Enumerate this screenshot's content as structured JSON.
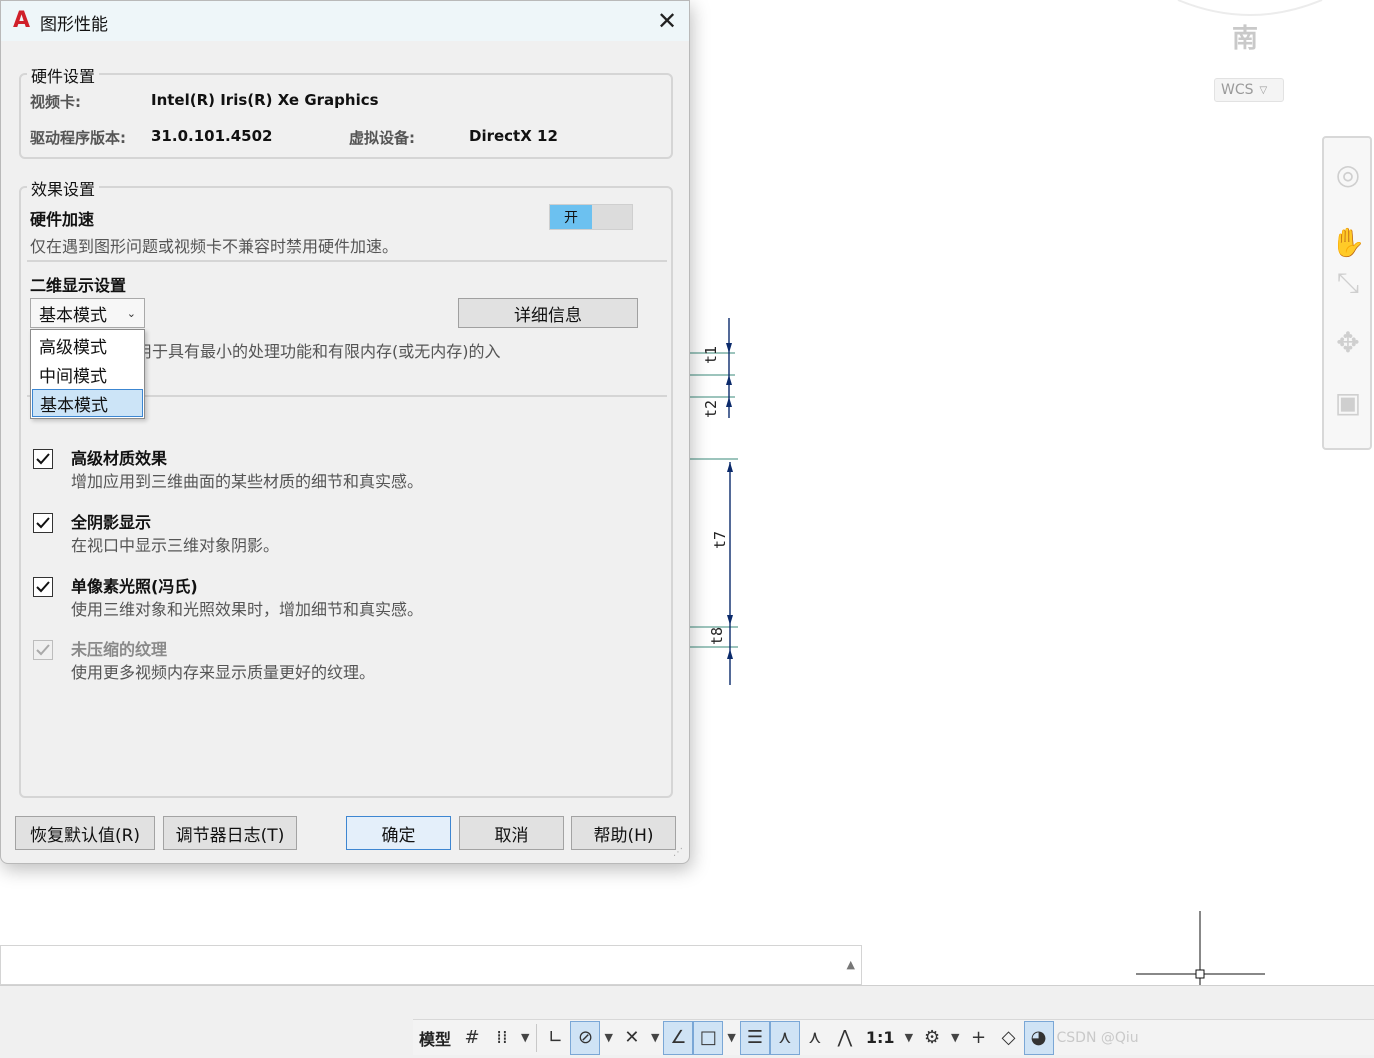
{
  "background": {
    "compass_label": "南",
    "wcs_label": "WCS",
    "dimension_labels": [
      "t1",
      "t2",
      "t7",
      "t8"
    ],
    "line_color": "#0b2a6b"
  },
  "status_bar": {
    "model_label": "模型",
    "scale_label": "1:1",
    "watermark": "CSDN @Qiu"
  },
  "dialog": {
    "title": "图形性能",
    "hardware_group": {
      "legend": "硬件设置",
      "video_card_label": "视频卡:",
      "video_card_value": "Intel(R) Iris(R) Xe Graphics",
      "driver_label": "驱动程序版本:",
      "driver_value": "31.0.101.4502",
      "virtual_device_label": "虚拟设备:",
      "virtual_device_value": "DirectX 12"
    },
    "effects_group": {
      "legend": "效果设置",
      "hw_accel_title": "硬件加速",
      "hw_accel_desc": "仅在遇到图形问题或视频卡不兼容时禁用硬件加速。",
      "hw_accel_toggle": "开",
      "display2d_title": "二维显示设置",
      "display2d_selected": "基本模式",
      "display2d_options": [
        "高级模式",
        "中间模式",
        "基本模式"
      ],
      "display2d_desc_partial": "用于具有最小的处理功能和有限内存(或无内存)的入",
      "details_button": "详细信息",
      "options": [
        {
          "title": "高级材质效果",
          "desc": "增加应用到三维曲面的某些材质的细节和真实感。",
          "checked": true,
          "enabled": true
        },
        {
          "title": "全阴影显示",
          "desc": "在视口中显示三维对象阴影。",
          "checked": true,
          "enabled": true
        },
        {
          "title": "单像素光照(冯氏)",
          "desc": "使用三维对象和光照效果时，增加细节和真实感。",
          "checked": true,
          "enabled": true
        },
        {
          "title": "未压缩的纹理",
          "desc": "使用更多视频内存来显示质量更好的纹理。",
          "checked": true,
          "enabled": false
        }
      ]
    },
    "buttons": {
      "restore": "恢复默认值(R)",
      "log": "调节器日志(T)",
      "ok": "确定",
      "cancel": "取消",
      "help": "帮助(H)"
    }
  }
}
